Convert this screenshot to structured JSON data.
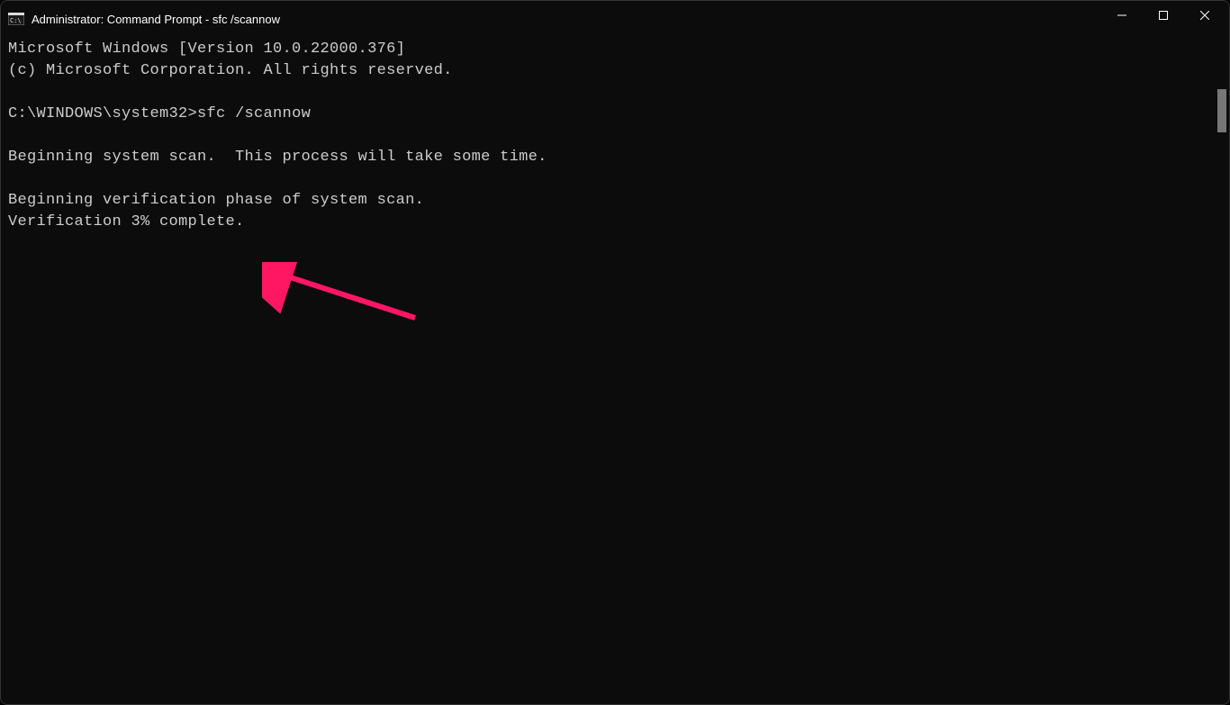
{
  "window": {
    "title": "Administrator: Command Prompt - sfc  /scannow"
  },
  "terminal": {
    "line_version": "Microsoft Windows [Version 10.0.22000.376]",
    "line_copyright": "(c) Microsoft Corporation. All rights reserved.",
    "prompt": "C:\\WINDOWS\\system32>",
    "command": "sfc /scannow",
    "line_begin_scan": "Beginning system scan.  This process will take some time.",
    "line_verification_phase": "Beginning verification phase of system scan.",
    "line_verification_progress": "Verification 3% complete."
  }
}
